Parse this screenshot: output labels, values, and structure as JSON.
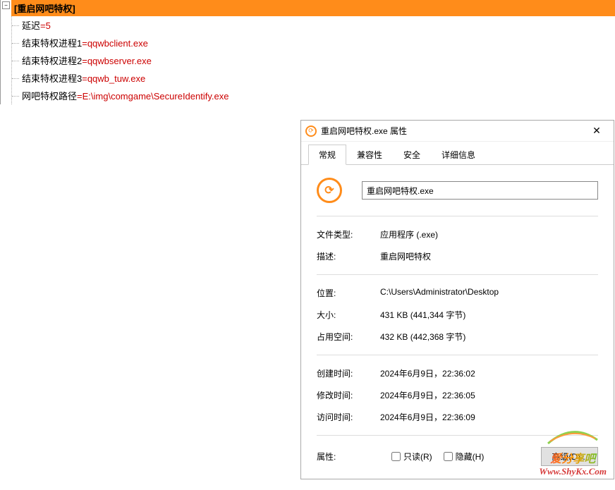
{
  "ini": {
    "section": "[重启网吧特权]",
    "lines": [
      {
        "key": "延迟",
        "val": "5"
      },
      {
        "key": "结束特权进程1",
        "val": "qqwbclient.exe"
      },
      {
        "key": "结束特权进程2",
        "val": "qqwbserver.exe"
      },
      {
        "key": "结束特权进程3",
        "val": "qqwb_tuw.exe"
      },
      {
        "key": "网吧特权路径",
        "val": "E:\\img\\comgame\\SecureIdentify.exe"
      }
    ]
  },
  "dialog": {
    "title": "重启网吧特权.exe 属性",
    "tabs": [
      "常规",
      "兼容性",
      "安全",
      "详细信息"
    ],
    "filename": "重启网吧特权.exe",
    "props": {
      "filetype_label": "文件类型:",
      "filetype_value": "应用程序 (.exe)",
      "desc_label": "描述:",
      "desc_value": "重启网吧特权",
      "location_label": "位置:",
      "location_value": "C:\\Users\\Administrator\\Desktop",
      "size_label": "大小:",
      "size_value": "431 KB (441,344 字节)",
      "disk_label": "占用空间:",
      "disk_value": "432 KB (442,368 字节)",
      "created_label": "创建时间:",
      "created_value": "2024年6月9日，22:36:02",
      "modified_label": "修改时间:",
      "modified_value": "2024年6月9日，22:36:05",
      "accessed_label": "访问时间:",
      "accessed_value": "2024年6月9日，22:36:09",
      "attr_label": "属性:",
      "readonly_label": "只读(R)",
      "hidden_label": "隐藏(H)",
      "advanced_btn": "高级(D)..."
    }
  },
  "watermark": {
    "line1": "爱分享吧",
    "line2": "Www.ShyKx.Com"
  }
}
